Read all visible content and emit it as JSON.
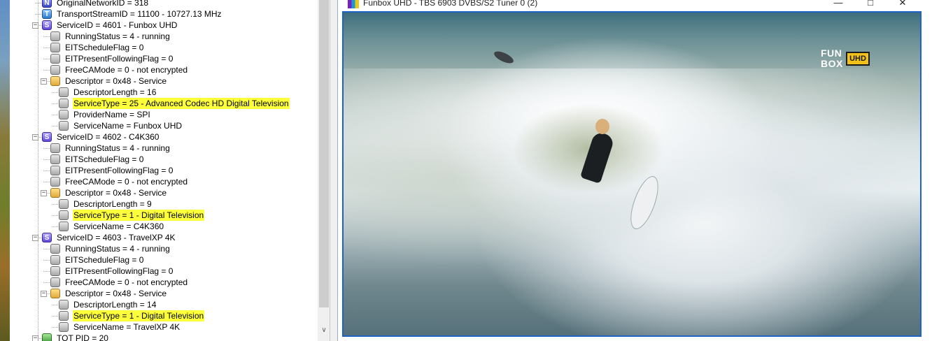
{
  "tree": {
    "nodes": [
      {
        "icon": "N",
        "text": "OriginalNetworkID = 318",
        "highlight": false
      },
      {
        "icon": "T",
        "text": "TransportStreamID = 11100 - 10727.13 MHz",
        "highlight": false
      },
      {
        "icon": "S",
        "text": "ServiceID = 4601 - Funbox UHD",
        "highlight": false
      },
      {
        "icon": "leaf",
        "text": "RunningStatus = 4 - running",
        "highlight": false
      },
      {
        "icon": "leaf",
        "text": "EITScheduleFlag = 0",
        "highlight": false
      },
      {
        "icon": "leaf",
        "text": "EITPresentFollowingFlag = 0",
        "highlight": false
      },
      {
        "icon": "leaf",
        "text": "FreeCAMode = 0 - not encrypted",
        "highlight": false
      },
      {
        "icon": "folder",
        "text": "Descriptor = 0x48 - Service",
        "highlight": false
      },
      {
        "icon": "leaf",
        "text": "DescriptorLength = 16",
        "highlight": false
      },
      {
        "icon": "leaf",
        "text": "ServiceType = 25 - Advanced Codec HD Digital Television",
        "highlight": true
      },
      {
        "icon": "leaf",
        "text": "ProviderName = SPI",
        "highlight": false
      },
      {
        "icon": "leaf",
        "text": "ServiceName = Funbox UHD",
        "highlight": false
      },
      {
        "icon": "S",
        "text": "ServiceID = 4602 - C4K360",
        "highlight": false
      },
      {
        "icon": "leaf",
        "text": "RunningStatus = 4 - running",
        "highlight": false
      },
      {
        "icon": "leaf",
        "text": "EITScheduleFlag = 0",
        "highlight": false
      },
      {
        "icon": "leaf",
        "text": "EITPresentFollowingFlag = 0",
        "highlight": false
      },
      {
        "icon": "leaf",
        "text": "FreeCAMode = 0 - not encrypted",
        "highlight": false
      },
      {
        "icon": "folder",
        "text": "Descriptor = 0x48 - Service",
        "highlight": false
      },
      {
        "icon": "leaf",
        "text": "DescriptorLength = 9",
        "highlight": false
      },
      {
        "icon": "leaf",
        "text": "ServiceType = 1 - Digital Television",
        "highlight": true
      },
      {
        "icon": "leaf",
        "text": "ServiceName = C4K360",
        "highlight": false
      },
      {
        "icon": "S",
        "text": "ServiceID = 4603 - TravelXP 4K",
        "highlight": false
      },
      {
        "icon": "leaf",
        "text": "RunningStatus = 4 - running",
        "highlight": false
      },
      {
        "icon": "leaf",
        "text": "EITScheduleFlag = 0",
        "highlight": false
      },
      {
        "icon": "leaf",
        "text": "EITPresentFollowingFlag = 0",
        "highlight": false
      },
      {
        "icon": "leaf",
        "text": "FreeCAMode = 0 - not encrypted",
        "highlight": false
      },
      {
        "icon": "folder",
        "text": "Descriptor = 0x48 - Service",
        "highlight": false
      },
      {
        "icon": "leaf",
        "text": "DescriptorLength = 14",
        "highlight": false
      },
      {
        "icon": "leaf",
        "text": "ServiceType = 1 - Digital Television",
        "highlight": true
      },
      {
        "icon": "leaf",
        "text": "ServiceName = TravelXP 4K",
        "highlight": false
      },
      {
        "icon": "Z",
        "text": "TOT PID = 20",
        "highlight": false
      }
    ],
    "highlight_color": "#fdff3a"
  },
  "video_window": {
    "title": "Funbox UHD - TBS 6903 DVBS/S2 Tuner 0 (2)",
    "minimize_icon": "minimize-icon",
    "maximize_icon": "maximize-icon",
    "close_icon": "close-icon",
    "channel_logo": {
      "line1": "FUN",
      "line2": "BOX",
      "badge": "UHD"
    },
    "frame_border_color": "#1e63c4"
  }
}
